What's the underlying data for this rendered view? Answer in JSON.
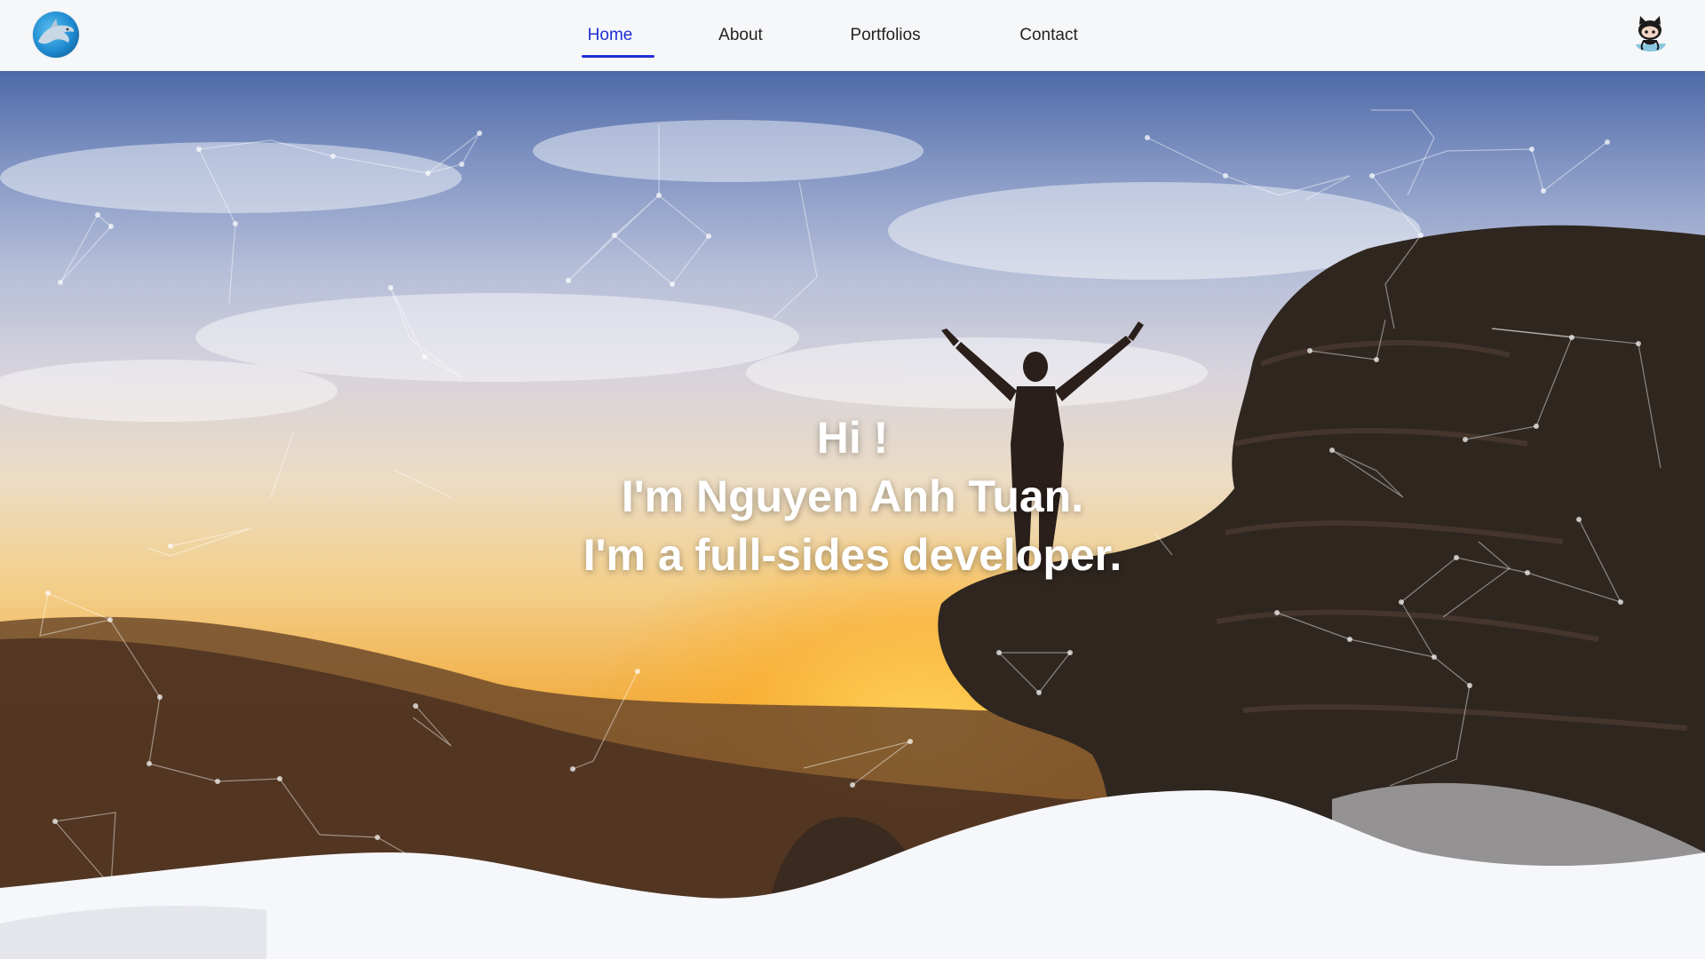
{
  "nav": {
    "logo_icon": "dolphin-logo-icon",
    "items": [
      {
        "label": "Home",
        "active": true
      },
      {
        "label": "About",
        "active": false
      },
      {
        "label": "Portfolios",
        "active": false
      },
      {
        "label": "Contact",
        "active": false
      }
    ],
    "github_icon": "github-octocat-icon",
    "accent": "#1f2fd6"
  },
  "hero": {
    "line1": "Hi !",
    "line2": "I'm Nguyen Anh Tuan.",
    "line3": "I'm a full-sides developer.",
    "background": "person-on-cliff-sunset-photo",
    "text_color": "#ffffff"
  }
}
